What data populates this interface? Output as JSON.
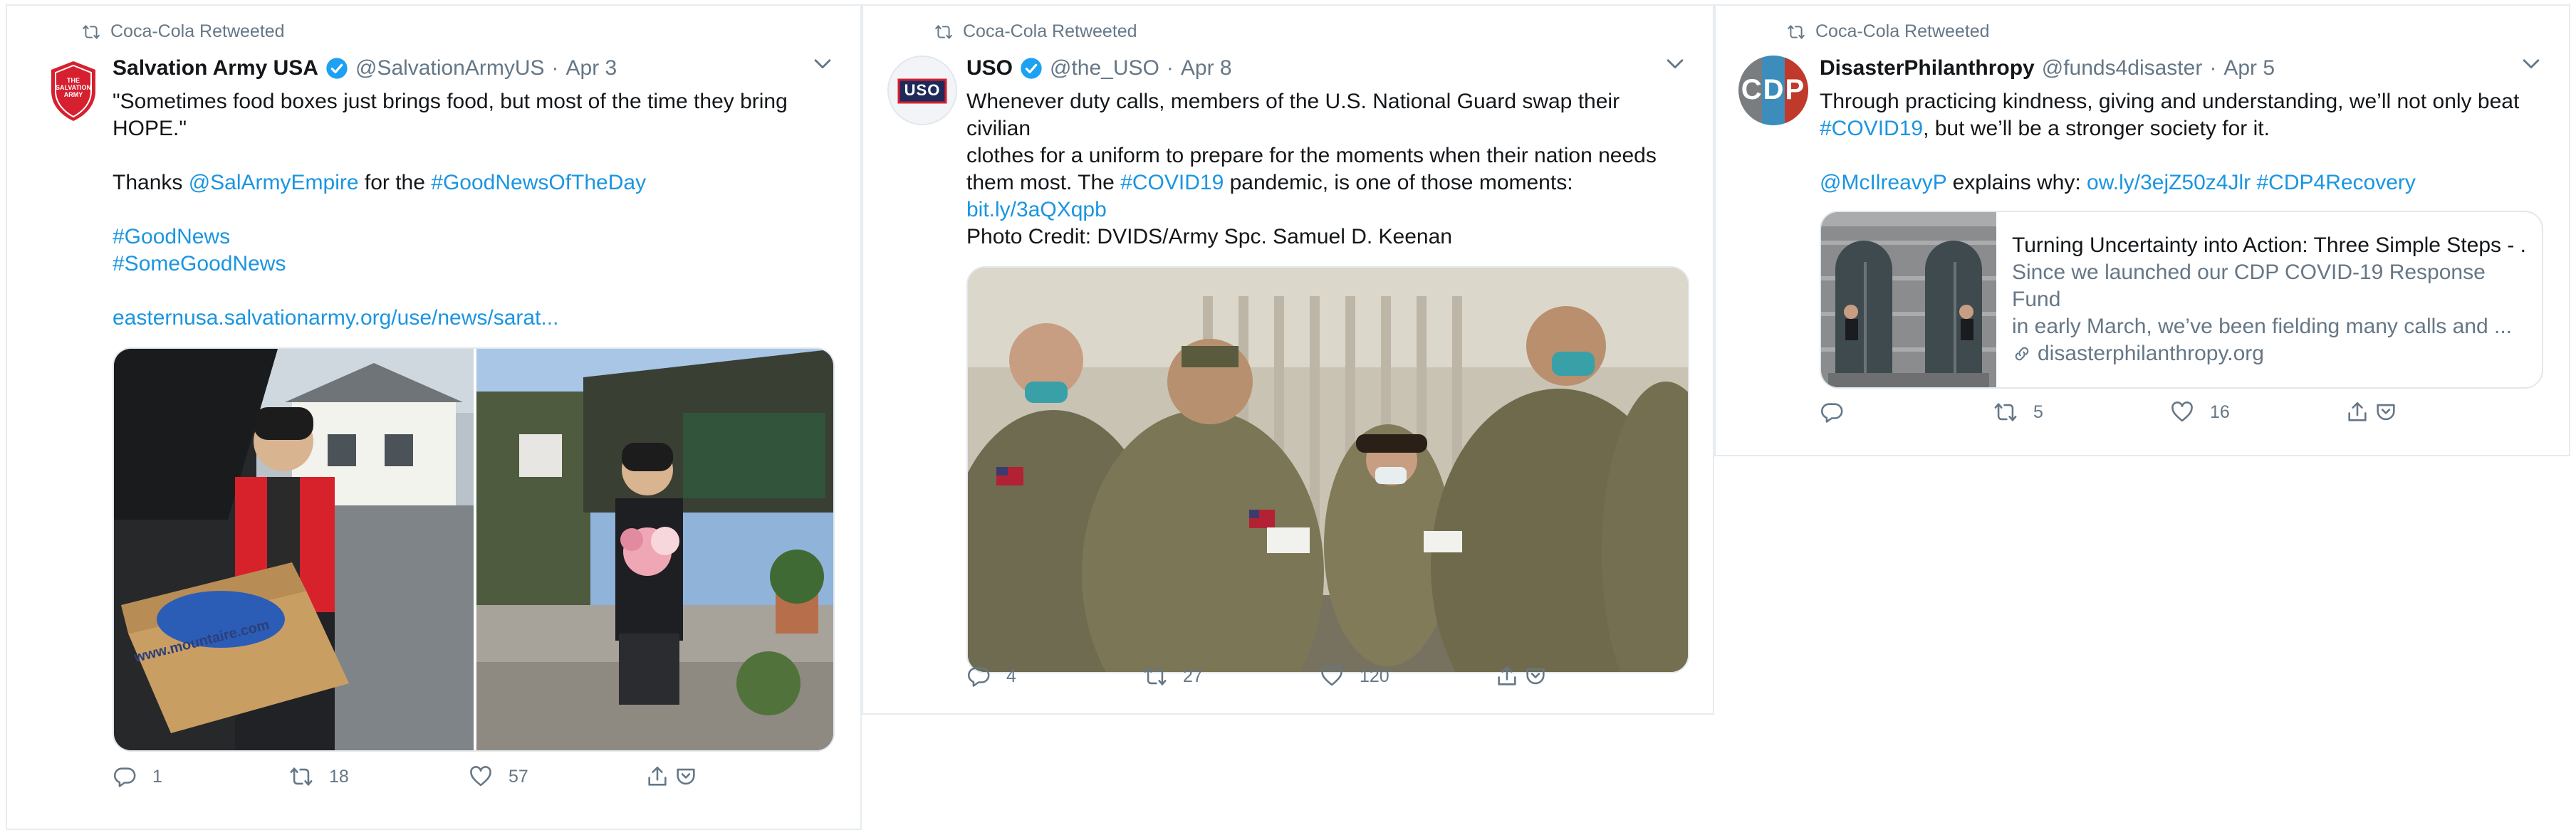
{
  "tweets": [
    {
      "retweeted_by": "Coca-Cola Retweeted",
      "name": "Salvation Army USA",
      "handle": "@SalvationArmyUS",
      "date": "Apr 3",
      "avatar_text": "THE SALVATION ARMY",
      "text_lines": [
        "\"Sometimes food boxes just brings food, but most of the time they bring",
        "HOPE.\""
      ],
      "thanks_prefix": "Thanks ",
      "thanks_mention": "@SalArmyEmpire",
      "thanks_mid": " for the ",
      "thanks_hashtag": "#GoodNewsOfTheDay",
      "hashtag1": "#GoodNews",
      "hashtag2": "#SomeGoodNews",
      "link": "easternusa.salvationarmy.org/use/news/sarat...",
      "box_print": "www.mountaire.com",
      "replies": "1",
      "retweets": "18",
      "likes": "57"
    },
    {
      "retweeted_by": "Coca-Cola Retweeted",
      "name": "USO",
      "handle": "@the_USO",
      "date": "Apr 8",
      "avatar_text": "USO",
      "line1": "Whenever duty calls, members of the U.S. National Guard swap their civilian",
      "line2": "clothes for a uniform to prepare for the moments when their nation needs",
      "line3_prefix": "them most. The ",
      "line3_hashtag": "#COVID19",
      "line3_suffix": " pandemic, is one of those moments:",
      "link": "bit.ly/3aQXqpb",
      "credit": "Photo Credit: DVIDS/Army Spc. Samuel D. Keenan",
      "replies": "4",
      "retweets": "27",
      "likes": "120"
    },
    {
      "retweeted_by": "Coca-Cola Retweeted",
      "name": "DisasterPhilanthropy",
      "handle": "@funds4disaster",
      "date": "Apr 5",
      "avatar_text": "CDP",
      "line1": "Through practicing kindness, giving and understanding, we’ll not only beat",
      "line2_hashtag": "#COVID19",
      "line2_suffix": ", but we’ll be a stronger society for it.",
      "mention": "@McIlreavyP",
      "explains": " explains why: ",
      "link": "ow.ly/3ejZ50z4Jlr",
      "hashtag": "#CDP4Recovery",
      "card_title": "Turning Uncertainty into Action: Three Simple Steps - ...",
      "card_desc_1": "Since we launched our CDP COVID-19 Response Fund",
      "card_desc_2": "in early March, we’ve been fielding many calls and ...",
      "card_domain": "disasterphilanthropy.org",
      "replies": "",
      "retweets": "5",
      "likes": "16"
    }
  ],
  "colors": {
    "link": "#1b95e0",
    "secondary_text": "#657786",
    "verified": "#1da1f2",
    "salvation_red": "#d6202f",
    "uso_navy": "#1f2a5a"
  }
}
